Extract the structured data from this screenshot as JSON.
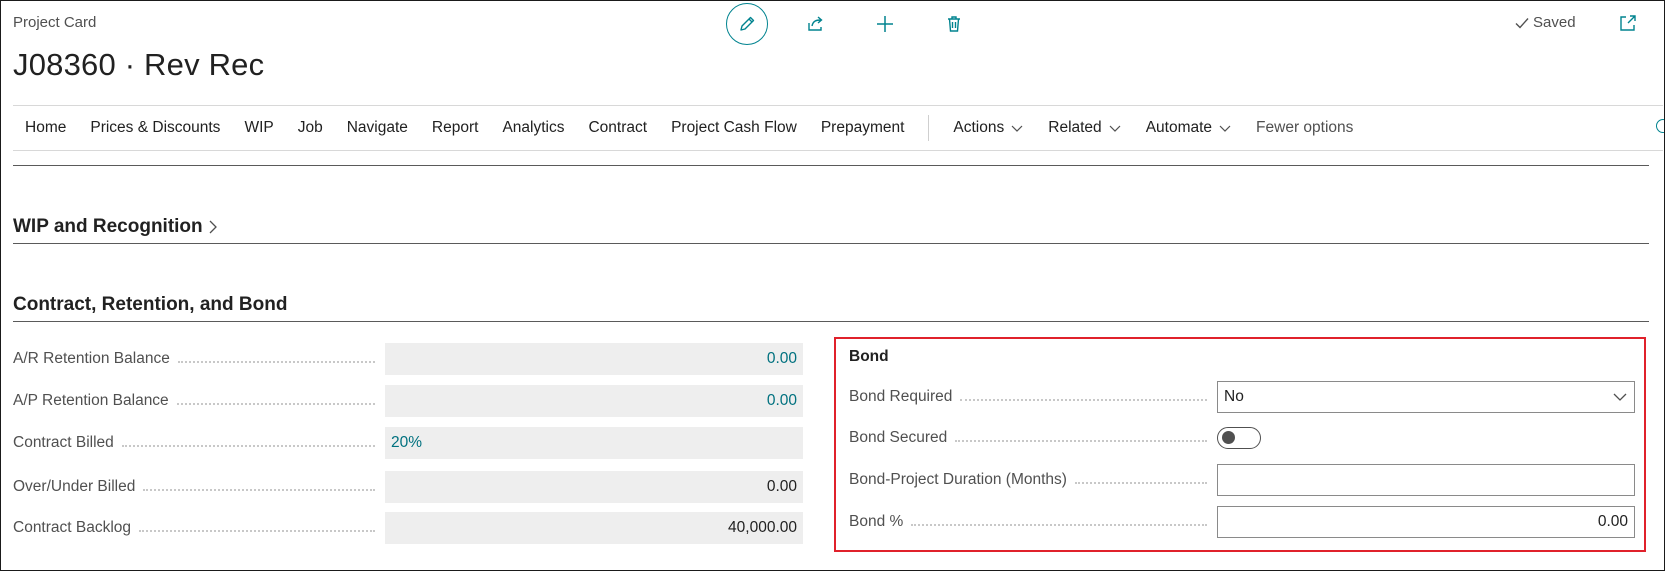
{
  "header": {
    "page_kind": "Project Card",
    "title": "J08360 · Rev Rec",
    "saved_label": "Saved"
  },
  "icons": {
    "edit": "pencil-icon",
    "share": "share-icon",
    "new": "plus-icon",
    "delete": "trash-icon",
    "saved": "check-icon",
    "popout": "open-in-new-window-icon",
    "search": "search-icon"
  },
  "colors": {
    "accent": "#00838f",
    "link": "#00717f",
    "highlight_box": "#e0212b",
    "field_bg": "#eeeeee"
  },
  "action_bar": {
    "items": [
      "Home",
      "Prices & Discounts",
      "WIP",
      "Job",
      "Navigate",
      "Report",
      "Analytics",
      "Contract",
      "Project Cash Flow",
      "Prepayment"
    ],
    "menus": [
      "Actions",
      "Related",
      "Automate"
    ],
    "fewer_options": "Fewer options"
  },
  "sections": {
    "wip": "WIP and Recognition",
    "contract": "Contract, Retention, and Bond"
  },
  "contract_fields": [
    {
      "label": "A/R Retention Balance",
      "value": "0.00"
    },
    {
      "label": "A/P Retention Balance",
      "value": "0.00"
    },
    {
      "label": "Contract Billed",
      "value": "20%"
    },
    {
      "label": "Over/Under Billed",
      "value": "0.00"
    },
    {
      "label": "Contract Backlog",
      "value": "40,000.00"
    }
  ],
  "bond": {
    "heading": "Bond",
    "required_label": "Bond Required",
    "required_value": "No",
    "secured_label": "Bond Secured",
    "secured_on": false,
    "duration_label": "Bond-Project Duration (Months)",
    "duration_value": "",
    "percent_label": "Bond %",
    "percent_value": "0.00"
  }
}
